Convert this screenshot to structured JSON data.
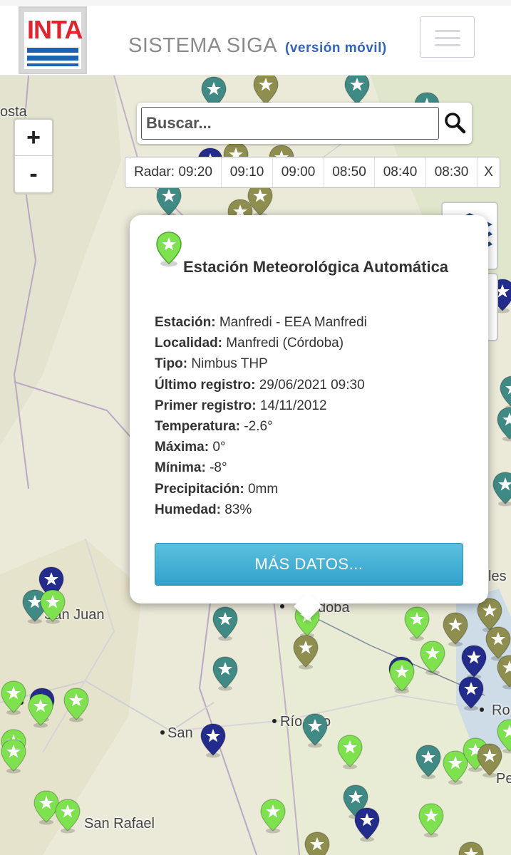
{
  "header": {
    "logo_text": "INTA",
    "title": "SISTEMA SIGA",
    "subtitle": "(versión móvil)"
  },
  "map": {
    "labels": {
      "san_juan": "San Juan",
      "cordoba": "doba",
      "rio_cuarto": "Río   arto",
      "san_luis": "San",
      "san_rafael": "San Rafael",
      "top_left": "osta",
      "rosario": "Ro",
      "right_edge": "les",
      "right_edge2": "Pe"
    },
    "marker_colors": {
      "green": "#7ee24e",
      "teal": "#3f8a84",
      "olive": "#8e8f4f",
      "navy": "#232b8c"
    }
  },
  "zoom": {
    "in": "+",
    "out": "-"
  },
  "search": {
    "placeholder": "Buscar..."
  },
  "radar": {
    "label": "Radar: 09:20",
    "times": [
      "09:10",
      "09:00",
      "08:50",
      "08:40",
      "08:30"
    ],
    "close": "X"
  },
  "popup": {
    "title": "Estación Meteorológica Automática",
    "fields": [
      {
        "label": "Estación:",
        "value": "Manfredi - EEA Manfredi"
      },
      {
        "label": "Localidad:",
        "value": "Manfredi (Córdoba)"
      },
      {
        "label": "Tipo:",
        "value": "Nimbus THP"
      },
      {
        "label": "Último registro:",
        "value": "29/06/2021 09:30"
      },
      {
        "label": "Primer registro:",
        "value": "14/11/2012"
      },
      {
        "label": "Temperatura:",
        "value": "-2.6°"
      },
      {
        "label": "Máxima:",
        "value": "0°"
      },
      {
        "label": "Mínima:",
        "value": "-8°"
      },
      {
        "label": "Precipitación:",
        "value": "0mm"
      },
      {
        "label": "Humedad:",
        "value": "83%"
      }
    ],
    "button": "MÁS DATOS..."
  }
}
